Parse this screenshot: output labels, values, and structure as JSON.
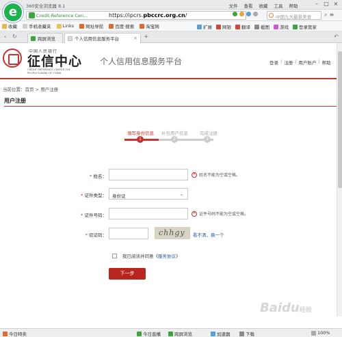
{
  "browser": {
    "title": "360安全浏览器 8.1",
    "menu": [
      "文件",
      "查看",
      "收藏",
      "工具",
      "帮助"
    ],
    "cert_label": "Credit Reference Cen...",
    "url_prefix": "https://ipcrs.",
    "url_domain": "pbccrc.org.cn",
    "url_suffix": "/",
    "search_placeholder": "中国九大最景美食",
    "favorites": [
      "收藏",
      "手机收藏夹",
      "Links",
      "网址导航",
      "百度·搜索",
      "淘宝网"
    ],
    "toolbar_right": [
      "扩展",
      "网银",
      "翻译",
      "截图",
      "游戏",
      "登录管家"
    ],
    "tabs": [
      {
        "label": "跨屏浏览"
      },
      {
        "label": "个人信用信息服务平台"
      }
    ],
    "status": {
      "left": "今日特卖",
      "live": "今日直播",
      "cross": "跨屏浏览",
      "accel": "加速器",
      "download": "下载",
      "zoom": "100%"
    }
  },
  "site": {
    "brand_top": "中国人民银行",
    "brand_main": "征信中心",
    "brand_en": "CREDIT REFERENCE CENTER THE PEOPLE'S BANK OF CHINA",
    "slogan": "个人信用信息服务平台",
    "top_links": {
      "login": "登录",
      "register": "注册",
      "account": "用户账户",
      "help": "帮助"
    },
    "breadcrumb": "当前位置：首页 > 用户注册",
    "section_title": "用户注册"
  },
  "steps": [
    {
      "label": "填写身份信息",
      "num": "1",
      "active": true
    },
    {
      "label": "补充用户信息",
      "num": "2",
      "active": false
    },
    {
      "label": "完成注册",
      "num": "3",
      "active": false
    }
  ],
  "form": {
    "name_label": "姓名：",
    "name_value": "",
    "name_error": "姓名不能为空或空格。",
    "idtype_label": "证件类型：",
    "idtype_value": "身份证",
    "idnum_label": "证件号码：",
    "idnum_value": "",
    "idnum_error": "证件号码不能为空或空格。",
    "captcha_label": "验证码：",
    "captcha_value": "",
    "captcha_text": "chhgy",
    "captcha_refresh": "看不清，换一个",
    "agree_text": "我已阅读并同意《",
    "agree_link": "服务协议",
    "agree_end": "》",
    "next_button": "下一步"
  },
  "watermark": {
    "main": "Baidu",
    "sub": "经验"
  },
  "colors": {
    "brand_red": "#c23531",
    "browser_green": "#1cb34f",
    "link_blue": "#2a54a6"
  }
}
